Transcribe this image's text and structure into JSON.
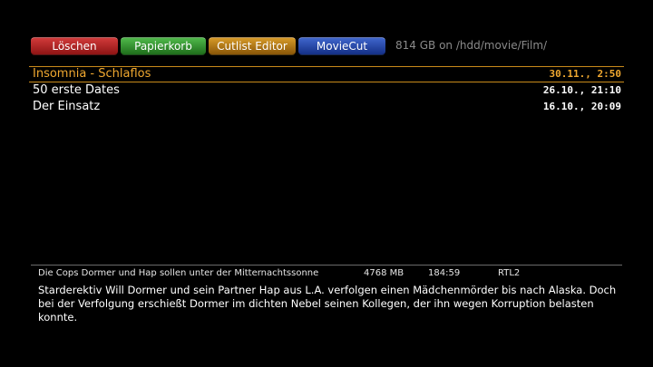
{
  "keys": {
    "red": "Löschen",
    "green": "Papierkorb",
    "yellow": "Cutlist Editor",
    "blue": "MovieCut"
  },
  "disk_info": "814 GB on /hdd/movie/Film/",
  "colors": {
    "background": "#000000",
    "selected_text": "#f0a830",
    "selected_border": "#c98a1a",
    "red_key": "#b02222",
    "green_key": "#2f8f2a",
    "yellow_key": "#b07414",
    "blue_key": "#2a4aaa"
  },
  "movies": [
    {
      "title": "Insomnia - Schlaflos",
      "date": "30.11., 2:50",
      "selected": true
    },
    {
      "title": "50 erste Dates",
      "date": "26.10., 21:10",
      "selected": false
    },
    {
      "title": "Der Einsatz",
      "date": "16.10., 20:09",
      "selected": false
    }
  ],
  "info": {
    "short_description": "Die Cops Dormer und Hap sollen unter der Mitternachtssonne",
    "size": "4768 MB",
    "length": "184:59",
    "channel": "RTL2",
    "description": "Starderektiv Will Dormer und sein Partner Hap aus L.A. verfolgen einen Mädchenmörder bis nach Alaska. Doch bei der Verfolgung erschießt Dormer im dichten Nebel seinen Kollegen, der ihn wegen Korruption belasten konnte."
  }
}
